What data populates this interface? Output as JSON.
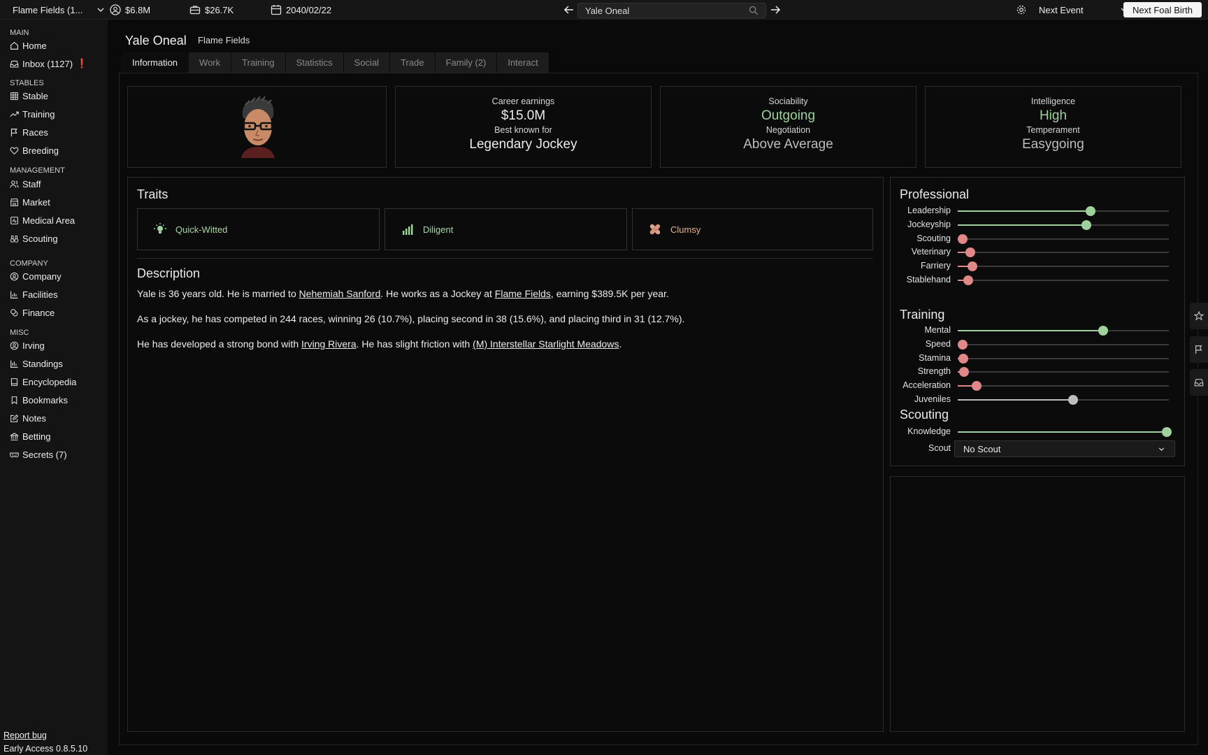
{
  "topbar": {
    "stable_name": "Flame Fields (1...",
    "cash": "$6.8M",
    "wallet": "$26.7K",
    "date": "2040/02/22",
    "search_value": "Yale Oneal",
    "next_event": "Next Event",
    "next_foal": "Next Foal Birth"
  },
  "sidebar": {
    "main_label": "MAIN",
    "home": "Home",
    "inbox": "Inbox (1127)",
    "stables_label": "STABLES",
    "stable": "Stable",
    "training": "Training",
    "races": "Races",
    "breeding": "Breeding",
    "management_label": "MANAGEMENT",
    "staff": "Staff",
    "market": "Market",
    "medical": "Medical Area",
    "scouting": "Scouting",
    "company_label": "COMPANY",
    "company": "Company",
    "facilities": "Facilities",
    "finance": "Finance",
    "misc_label": "MISC",
    "irving": "Irving",
    "standings": "Standings",
    "encyclopedia": "Encyclopedia",
    "bookmarks": "Bookmarks",
    "notes": "Notes",
    "betting": "Betting",
    "secrets": "Secrets (7)",
    "report_bug": "Report bug",
    "version": "Early Access 0.8.5.10"
  },
  "person": {
    "name": "Yale Oneal",
    "stable": "Flame Fields"
  },
  "tabs": [
    "Information",
    "Work",
    "Training",
    "Statistics",
    "Social",
    "Trade",
    "Family (2)",
    "Interact"
  ],
  "cards": {
    "career_label": "Career earnings",
    "career_value": "$15.0M",
    "known_label": "Best known for",
    "known_value": "Legendary Jockey",
    "sociability_label": "Sociability",
    "sociability_value": "Outgoing",
    "negotiation_label": "Negotiation",
    "negotiation_value": "Above Average",
    "intelligence_label": "Intelligence",
    "intelligence_value": "High",
    "temperament_label": "Temperament",
    "temperament_value": "Easygoing"
  },
  "traits": {
    "title": "Traits",
    "items": [
      "Quick-Witted",
      "Diligent",
      "Clumsy"
    ]
  },
  "description": {
    "title": "Description",
    "p1_a": "Yale is 36 years old. He is married to ",
    "p1_link1": "Nehemiah Sanford",
    "p1_b": ". He works as a Jockey at ",
    "p1_link2": "Flame Fields",
    "p1_c": ", earning $389.5K per year.",
    "p2": "As a jockey, he has competed in 244 races, winning 26 (10.7%), placing second in 38 (15.6%), and placing third in 31 (12.7%).",
    "p3_a": "He has developed a strong bond with ",
    "p3_link1": "Irving Rivera",
    "p3_b": ". He has slight friction with ",
    "p3_link2": "(M) Interstellar Starlight Meadows",
    "p3_c": "."
  },
  "professional": {
    "title": "Professional",
    "skills": [
      {
        "label": "Leadership",
        "level": 0.63,
        "color": "#9fd19f"
      },
      {
        "label": "Jockeyship",
        "level": 0.61,
        "color": "#9fd19f"
      },
      {
        "label": "Scouting",
        "level": 0.02,
        "color": "#e08787"
      },
      {
        "label": "Veterinary",
        "level": 0.06,
        "color": "#e08787"
      },
      {
        "label": "Farriery",
        "level": 0.07,
        "color": "#e08787"
      },
      {
        "label": "Stablehand",
        "level": 0.05,
        "color": "#e08787"
      }
    ]
  },
  "training": {
    "title": "Training",
    "skills": [
      {
        "label": "Mental",
        "level": 0.69,
        "color": "#9fd19f"
      },
      {
        "label": "Speed",
        "level": 0.02,
        "color": "#e08787"
      },
      {
        "label": "Stamina",
        "level": 0.025,
        "color": "#e08787"
      },
      {
        "label": "Strength",
        "level": 0.03,
        "color": "#e08787"
      },
      {
        "label": "Acceleration",
        "level": 0.09,
        "color": "#e08787"
      },
      {
        "label": "Juveniles",
        "level": 0.545,
        "color": "#bdbdbd"
      }
    ]
  },
  "scouting": {
    "title": "Scouting",
    "knowledge_label": "Knowledge",
    "knowledge_level": 0.99,
    "knowledge_color": "#9fd19f",
    "scout_label": "Scout",
    "scout_value": "No Scout"
  }
}
